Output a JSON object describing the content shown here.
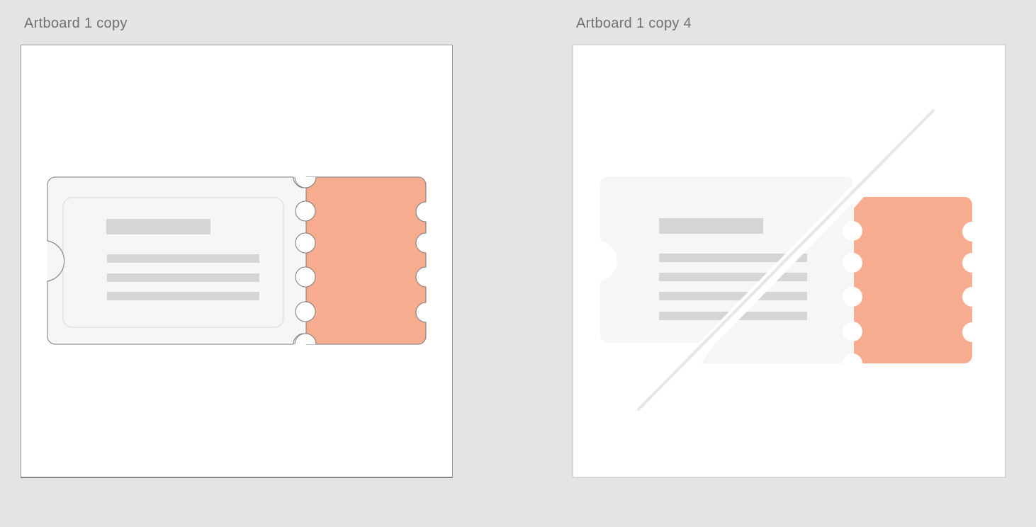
{
  "artboards": [
    {
      "label": "Artboard 1 copy",
      "illustration": "ticket-icon",
      "state": "active"
    },
    {
      "label": "Artboard 1 copy 4",
      "illustration": "ticket-disabled-icon",
      "state": "strikethrough"
    }
  ],
  "colors": {
    "canvas_background": "#e4e4e4",
    "artboard_background": "#ffffff",
    "ticket_body": "#f6f6f6",
    "ticket_stub": "#f7ac8f",
    "ticket_lines": "#d5d5d5",
    "slash_line": "#e6e6e6",
    "outline": "#7a7a7a"
  }
}
